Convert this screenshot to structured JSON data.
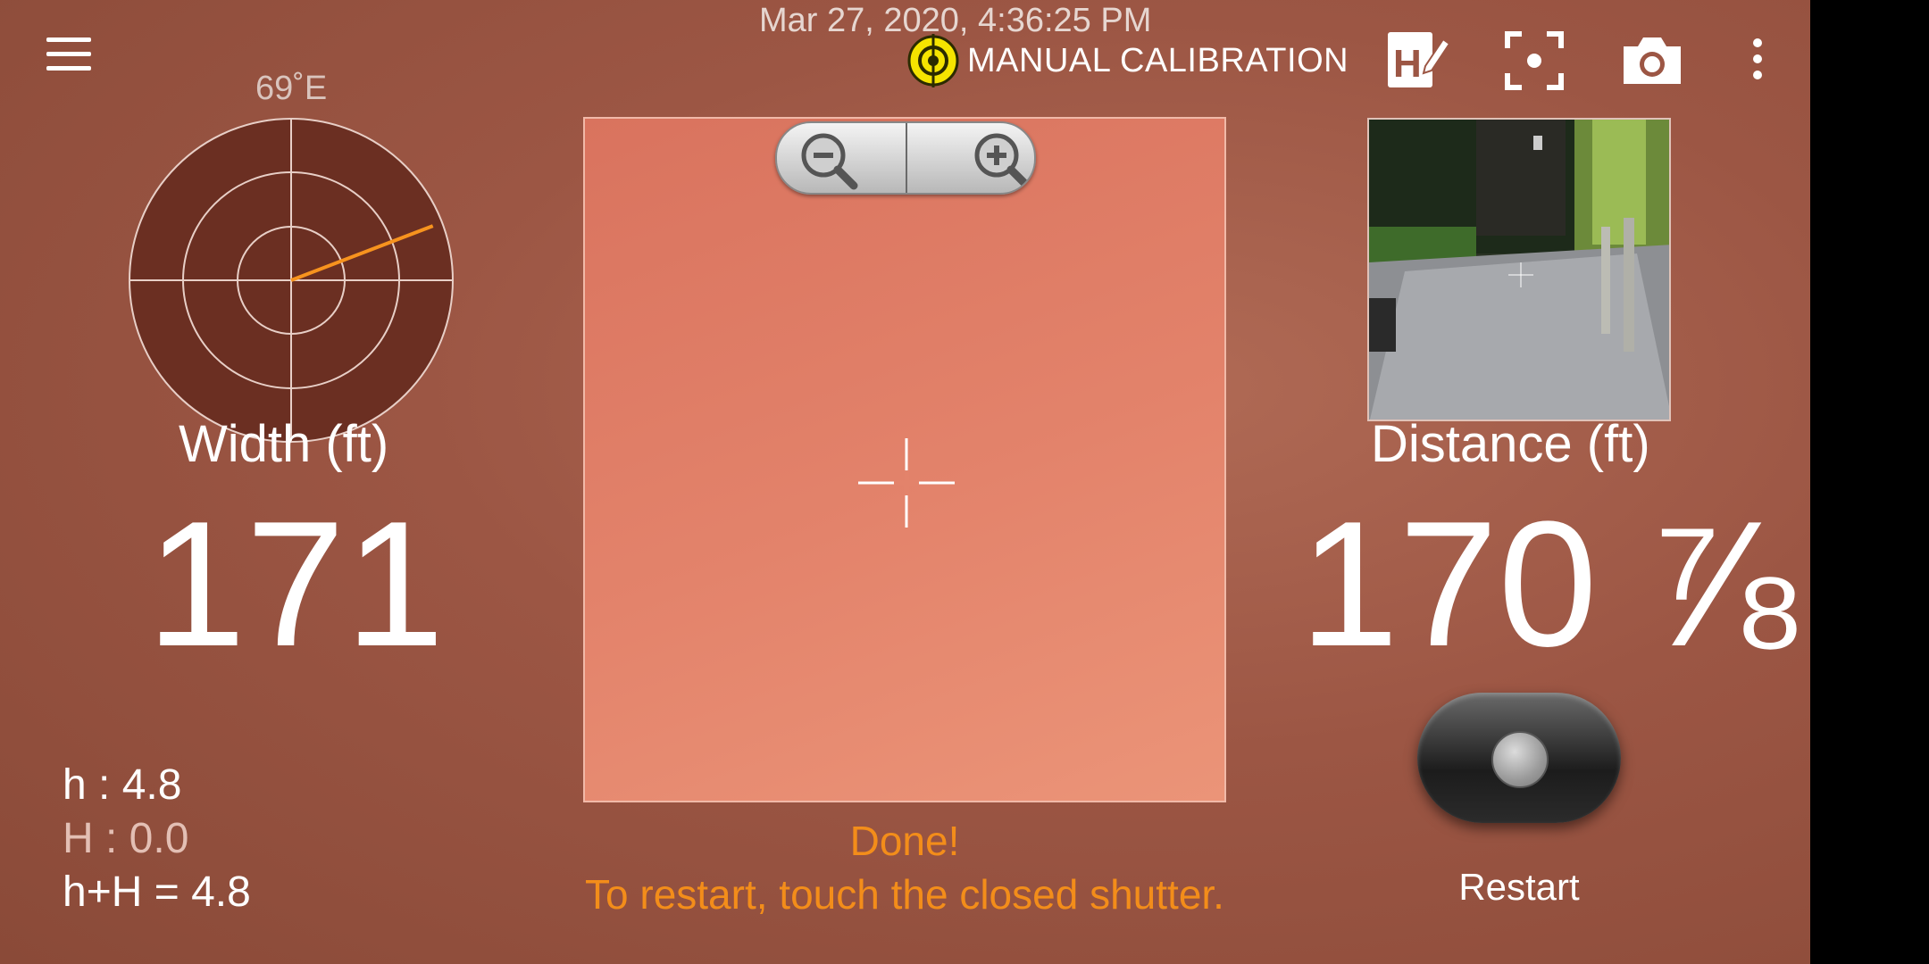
{
  "header": {
    "timestamp": "Mar 27, 2020, 4:36:25 PM",
    "calibration_label": "MANUAL CALIBRATION"
  },
  "compass": {
    "heading_label": "69˚E",
    "heading_degrees": 69
  },
  "width": {
    "label": "Width (ft)",
    "value": "171"
  },
  "distance": {
    "label": "Distance (ft)",
    "value": "170 ⅞"
  },
  "stats": {
    "h": "h : 4.8",
    "H": "H : 0.0",
    "sum": "h+H = 4.8"
  },
  "status": {
    "line1": "Done!",
    "line2": "To restart, touch the closed shutter."
  },
  "shutter": {
    "label": "Restart"
  },
  "icons": {
    "menu": "hamburger-menu-icon",
    "calibration": "target-icon",
    "edit": "height-edit-icon",
    "focus": "focus-frame-icon",
    "camera": "camera-icon",
    "overflow": "more-vert-icon",
    "zoom_out": "zoom-out-icon",
    "zoom_in": "zoom-in-icon"
  },
  "colors": {
    "accent": "#f38d1a",
    "compass_needle": "#f7931e",
    "target_yellow": "#f5e400"
  }
}
